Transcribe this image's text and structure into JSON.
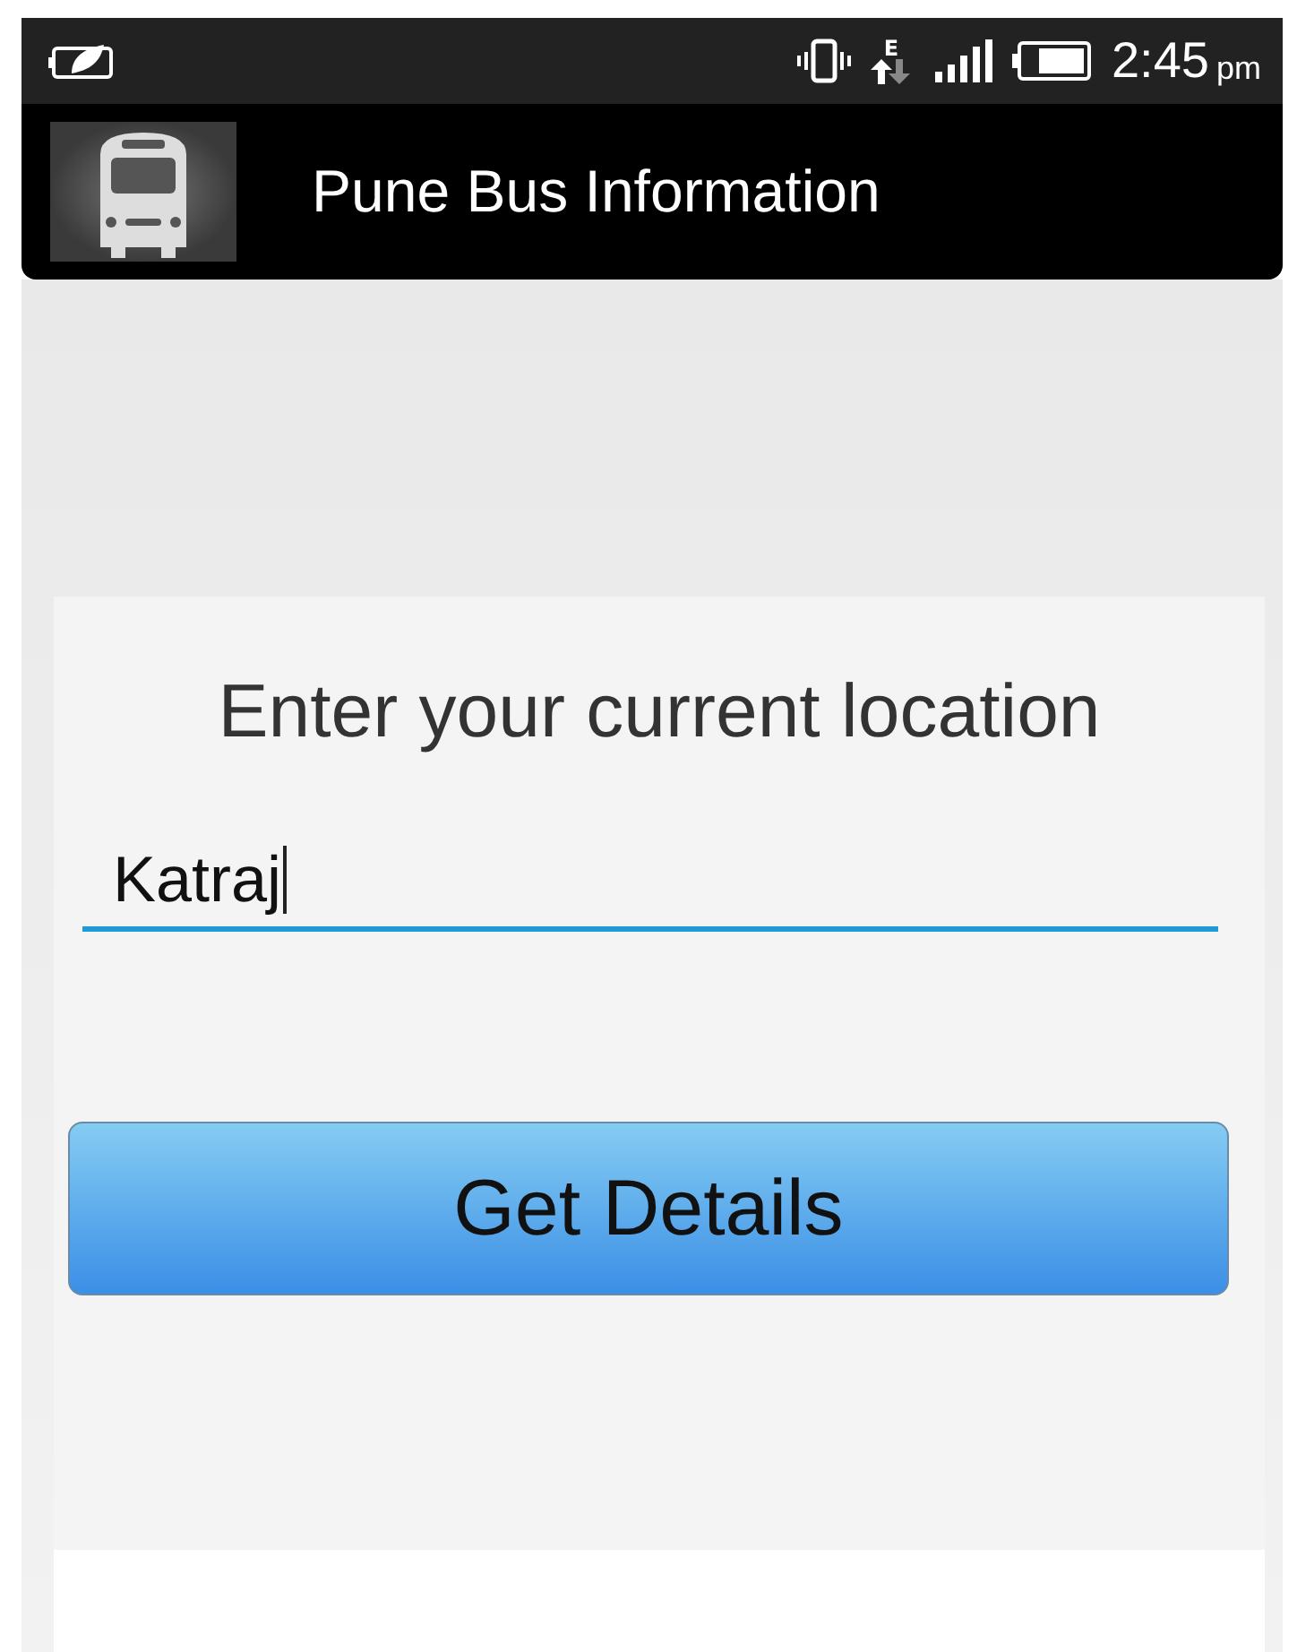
{
  "status_bar": {
    "network_type": "E",
    "time": "2:45",
    "period": "pm"
  },
  "app_bar": {
    "title": "Pune Bus Information"
  },
  "form": {
    "prompt": "Enter your current location",
    "location_field": {
      "value": "Katraj",
      "focused": true
    },
    "button": "Get Details"
  }
}
